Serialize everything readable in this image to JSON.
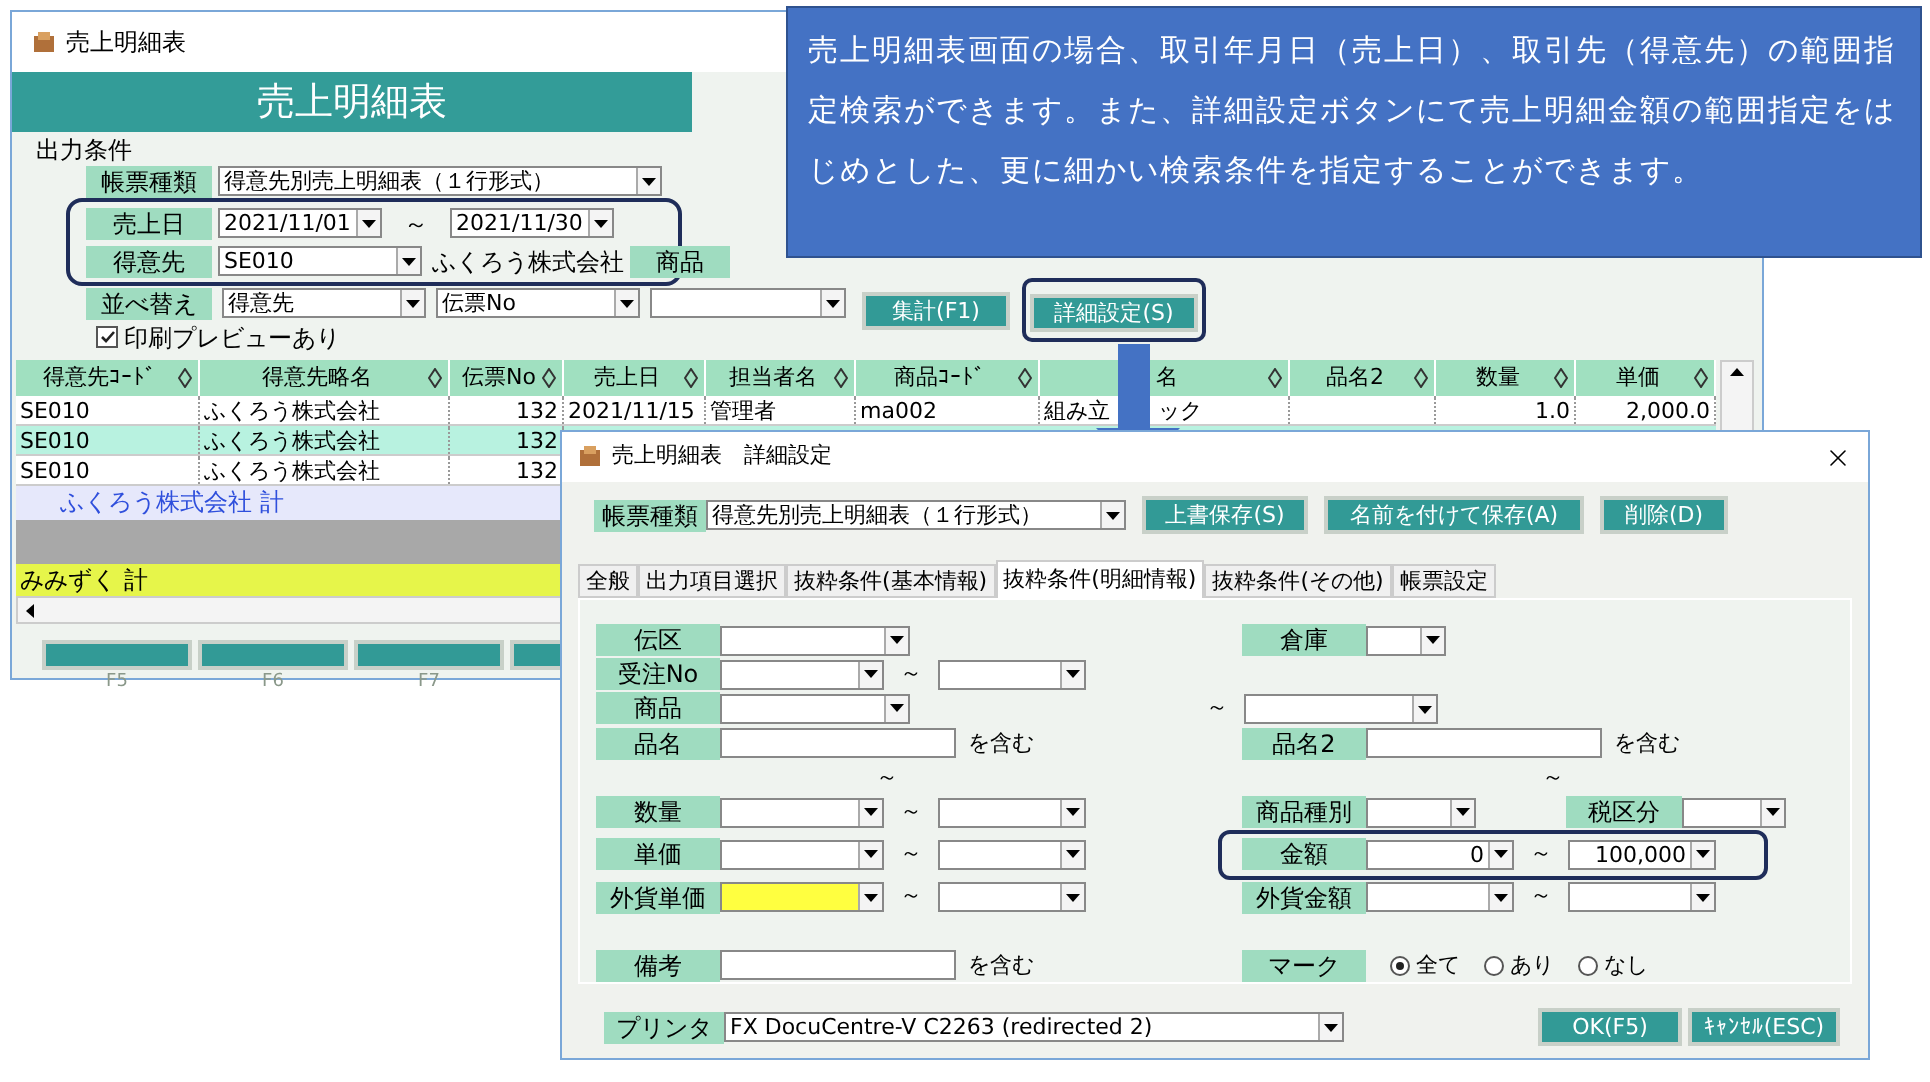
{
  "main_window": {
    "title": "売上明細表",
    "header": "売上明細表",
    "conditions_title": "出力条件",
    "conditions": [
      {
        "kind": "select",
        "label": "帳票種類",
        "value": "得意先別売上明細表（１行形式）",
        "outlined": false
      },
      {
        "kind": "date_range",
        "label": "売上日",
        "from": "2021/11/01",
        "separator": "～",
        "to": "2021/11/30",
        "outlined": true
      },
      {
        "kind": "customer",
        "label": "得意先",
        "value": "SE010",
        "name": "ふくろう株式会社",
        "extra_label": "商品",
        "outlined": true
      },
      {
        "kind": "sort",
        "label": "並べ替え",
        "fields": [
          {
            "kind": "select",
            "value": "得意先"
          },
          {
            "kind": "select",
            "value": "伝票No"
          },
          {
            "kind": "blank_select"
          }
        ],
        "outlined": false
      },
      {
        "kind": "checkbox",
        "label": "印刷プレビューあり",
        "checked": true,
        "outlined": false
      }
    ],
    "buttons": [
      {
        "label": "集計(F1)",
        "outlined": false
      },
      {
        "label": "詳細設定(S)",
        "outlined": true
      }
    ],
    "table": {
      "columns": [
        "得意先ｺｰﾄﾞ",
        "得意先略名",
        "伝票No",
        "売上日",
        "担当者名",
        "商品ｺｰﾄﾞ",
        "名",
        "品名2",
        "数量",
        "単価"
      ],
      "rows": [
        {
          "selected": false,
          "cells": [
            "SE010",
            "ふくろう株式会社",
            "132",
            "2021/11/15",
            "管理者",
            "ma002",
            {
              "parts": [
                "組み立",
                "ック"
              ]
            },
            "",
            "1.0",
            "2,000.0"
          ]
        },
        {
          "selected": true,
          "cells": [
            "SE010",
            "ふくろう株式会社",
            "132"
          ]
        },
        {
          "selected": false,
          "cells": [
            "SE010",
            "ふくろう株式会社",
            "132"
          ]
        }
      ],
      "totals": [
        {
          "kind": "group",
          "text": "ふくろう株式会社 計"
        },
        {
          "kind": "blank"
        },
        {
          "kind": "grand",
          "text": "みみずく 計"
        }
      ]
    },
    "function_keys": [
      {
        "kind": "labeled",
        "label": "F5"
      },
      {
        "kind": "labeled",
        "label": "F6"
      },
      {
        "kind": "labeled",
        "label": "F7"
      },
      {
        "kind": "unlabeled"
      }
    ]
  },
  "callout": {
    "text": "売上明細表画面の場合、取引年月日（売上日）、取引先（得意先）の範囲指定検索ができます。また、詳細設定ボタンにて売上明細金額の範囲指定をはじめとした、更に細かい検索条件を指定することができます。"
  },
  "dialog": {
    "title": "売上明細表　詳細設定",
    "report_type": {
      "label": "帳票種類",
      "value": "得意先別売上明細表（１行形式）"
    },
    "buttons": [
      "上書保存(S)",
      "名前を付けて保存(A)",
      "削除(D)"
    ],
    "tabs": [
      {
        "label": "全般",
        "selected": false
      },
      {
        "label": "出力項目選択",
        "selected": false
      },
      {
        "label": "抜粋条件(基本情報)",
        "selected": false
      },
      {
        "label": "抜粋条件(明細情報)",
        "selected": true
      },
      {
        "label": "抜粋条件(その他)",
        "selected": false
      },
      {
        "label": "帳票設定",
        "selected": false
      }
    ],
    "rows": [
      {
        "kind": "fields",
        "left": {
          "kind": "select",
          "label": "伝区"
        },
        "right": {
          "kind": "select",
          "label": "倉庫",
          "small": true
        }
      },
      {
        "kind": "fields",
        "left": {
          "kind": "range",
          "label": "受注No",
          "separator": "～"
        }
      },
      {
        "kind": "fields",
        "left": {
          "kind": "select",
          "label": "商品"
        },
        "right": {
          "kind": "tilde_select",
          "separator": "～"
        }
      },
      {
        "kind": "fields",
        "left": {
          "kind": "text",
          "label": "品名",
          "suffix": "を含む"
        },
        "right": {
          "kind": "text",
          "label": "品名2",
          "suffix": "を含む"
        }
      },
      {
        "kind": "fields",
        "left": {
          "kind": "tilde",
          "separator": "～"
        },
        "right": {
          "kind": "tilde",
          "separator": "～"
        }
      },
      {
        "kind": "fields",
        "left": {
          "kind": "range",
          "label": "数量",
          "separator": "～"
        },
        "right": {
          "kind": "pair",
          "label": "商品種別",
          "label2": "税区分"
        }
      },
      {
        "kind": "fields",
        "left": {
          "kind": "range",
          "label": "単価",
          "separator": "～"
        },
        "right": {
          "kind": "range",
          "label": "金額",
          "from": "0",
          "separator": "～",
          "to": "100,000",
          "outlined": true
        }
      },
      {
        "kind": "fields",
        "left": {
          "kind": "range",
          "label": "外貨単価",
          "separator": "～",
          "focused": true
        },
        "right": {
          "kind": "range",
          "label": "外貨金額",
          "separator": "～"
        }
      },
      {
        "kind": "spacer"
      },
      {
        "kind": "fields",
        "left": {
          "kind": "text",
          "label": "備考",
          "suffix": "を含む"
        },
        "right": {
          "kind": "radio",
          "label": "マーク",
          "options": [
            {
              "label": "全て",
              "selected": true
            },
            {
              "label": "あり",
              "selected": false
            },
            {
              "label": "なし",
              "selected": false
            }
          ]
        }
      }
    ],
    "printer": {
      "label": "プリンタ",
      "value": "FX DocuCentre-V C2263 (redirected 2)"
    },
    "footer_buttons": [
      "OK(F5)",
      "ｷｬﾝｾﾙ(ESC)"
    ]
  }
}
